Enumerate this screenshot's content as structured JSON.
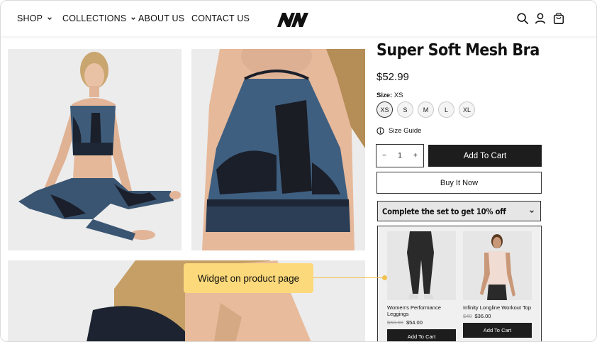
{
  "header": {
    "nav": [
      "SHOP",
      "COLLECTIONS",
      "ABOUT US",
      "CONTACT US"
    ],
    "logo_text": "NW"
  },
  "product": {
    "title": "Super Soft Mesh Bra",
    "price": "$52.99",
    "size_label": "Size:",
    "size_selected": "XS",
    "sizes": [
      "XS",
      "S",
      "M",
      "L",
      "XL"
    ],
    "size_guide": "Size Guide",
    "qty": {
      "minus": "−",
      "value": "1",
      "plus": "+"
    },
    "add_to_cart": "Add To Cart",
    "buy_now": "Buy It Now"
  },
  "bundle": {
    "heading": "Complete the set to get 10% off",
    "items": [
      {
        "name": "Women's Performance Leggings",
        "old_price": "$60.00",
        "price": "$54.00",
        "button": "Add To Cart"
      },
      {
        "name": "Infinity Longline Workout Top",
        "old_price": "$40",
        "price": "$36.00",
        "button": "Add To Cart"
      }
    ]
  },
  "callout": {
    "text": "Widget on product page",
    "color": "#fcd97a"
  },
  "icons": {
    "search": "search-icon",
    "account": "account-icon",
    "cart": "cart-icon"
  }
}
